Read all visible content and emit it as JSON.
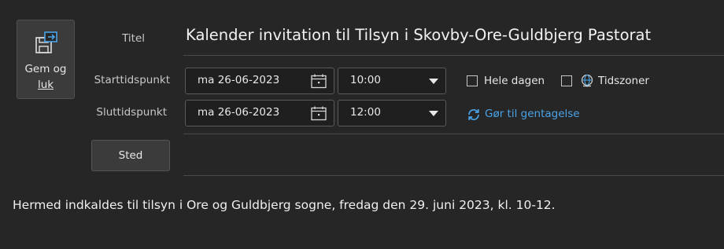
{
  "toolbar": {
    "save_close_line1": "Gem og",
    "save_close_line2": "luk"
  },
  "form": {
    "title_label": "Titel",
    "title_value": "Kalender invitation til Tilsyn i Skovby-Ore-Guldbjerg Pastorat",
    "start_label": "Starttidspunkt",
    "start_date": "ma 26-06-2023",
    "start_time": "10:00",
    "end_label": "Sluttidspunkt",
    "end_date": "ma 26-06-2023",
    "end_time": "12:00",
    "all_day_label": "Hele dagen",
    "time_zones_label": "Tidszoner",
    "recurrence_label": "Gør til gentagelse",
    "location_button": "Sted"
  },
  "body": {
    "text": "Hermed indkaldes til tilsyn i Ore og Guldbjerg sogne, fredag den 29. juni 2023, kl. 10-12."
  },
  "colors": {
    "background": "#262626",
    "link_accent": "#4aa3e6"
  },
  "icons": {
    "save_close": "save-close-icon",
    "calendar": "calendar-icon",
    "dropdown": "chevron-down-icon",
    "globe": "globe-icon",
    "recurrence": "recurrence-icon"
  }
}
